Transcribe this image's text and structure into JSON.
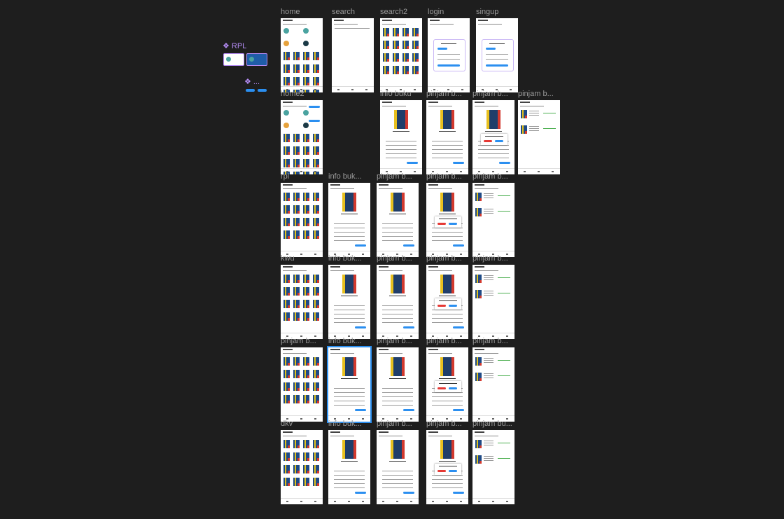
{
  "component": {
    "title": "RPL",
    "title_icon": "component-icon",
    "subtitle": "...",
    "accent": "#b58cf5"
  },
  "frames": [
    {
      "id": "home",
      "label": "home",
      "kind": "home"
    },
    {
      "id": "search",
      "label": "search",
      "kind": "search"
    },
    {
      "id": "search2",
      "label": "search2",
      "kind": "grid"
    },
    {
      "id": "login",
      "label": "login",
      "kind": "login"
    },
    {
      "id": "singup",
      "label": "singup",
      "kind": "login"
    },
    {
      "id": "home2",
      "label": "home2",
      "kind": "home2"
    },
    {
      "id": "info-buku-1",
      "label": "info buku",
      "kind": "info"
    },
    {
      "id": "pinjam-1a",
      "label": "pinjam b...",
      "kind": "info"
    },
    {
      "id": "pinjam-1b",
      "label": "pinjam b...",
      "kind": "dialog"
    },
    {
      "id": "pinjam-1c",
      "label": "pinjam b...",
      "kind": "list"
    },
    {
      "id": "rpl",
      "label": "rpl",
      "kind": "grid"
    },
    {
      "id": "info-buku-2",
      "label": "info buk...",
      "kind": "info"
    },
    {
      "id": "pinjam-2a",
      "label": "pinjam b...",
      "kind": "info"
    },
    {
      "id": "pinjam-2b",
      "label": "pinjam b...",
      "kind": "dialog"
    },
    {
      "id": "pinjam-2c",
      "label": "pinjam b...",
      "kind": "list"
    },
    {
      "id": "kwu",
      "label": "kwu",
      "kind": "grid"
    },
    {
      "id": "info-buku-3",
      "label": "info buk...",
      "kind": "info"
    },
    {
      "id": "pinjam-3a",
      "label": "pinjam b...",
      "kind": "info"
    },
    {
      "id": "pinjam-3b",
      "label": "pinjam b...",
      "kind": "dialog"
    },
    {
      "id": "pinjam-3c",
      "label": "pinjam b...",
      "kind": "list"
    },
    {
      "id": "pinjam-4",
      "label": "pinjam b...",
      "kind": "grid"
    },
    {
      "id": "info-buku-4",
      "label": "info buk...",
      "kind": "info",
      "selected": true
    },
    {
      "id": "pinjam-4a",
      "label": "pinjam b...",
      "kind": "info"
    },
    {
      "id": "pinjam-4b",
      "label": "pinjam b...",
      "kind": "dialog"
    },
    {
      "id": "pinjam-4c",
      "label": "pinjam b...",
      "kind": "list"
    },
    {
      "id": "dkv",
      "label": "dkv",
      "kind": "grid"
    },
    {
      "id": "info-buku-5",
      "label": "info buk...",
      "kind": "info"
    },
    {
      "id": "pinjam-5a",
      "label": "pinjam b...",
      "kind": "info"
    },
    {
      "id": "pinjam-5b",
      "label": "pinjam b...",
      "kind": "dialog"
    },
    {
      "id": "pinjam-5c",
      "label": "pinjam bu...",
      "kind": "list"
    }
  ],
  "colors": {
    "canvas": "#1e1e1e",
    "label": "#9a9a9a",
    "selection": "#2b8ff0",
    "primary_button": "#2b8ff0",
    "danger_button": "#e53935"
  }
}
